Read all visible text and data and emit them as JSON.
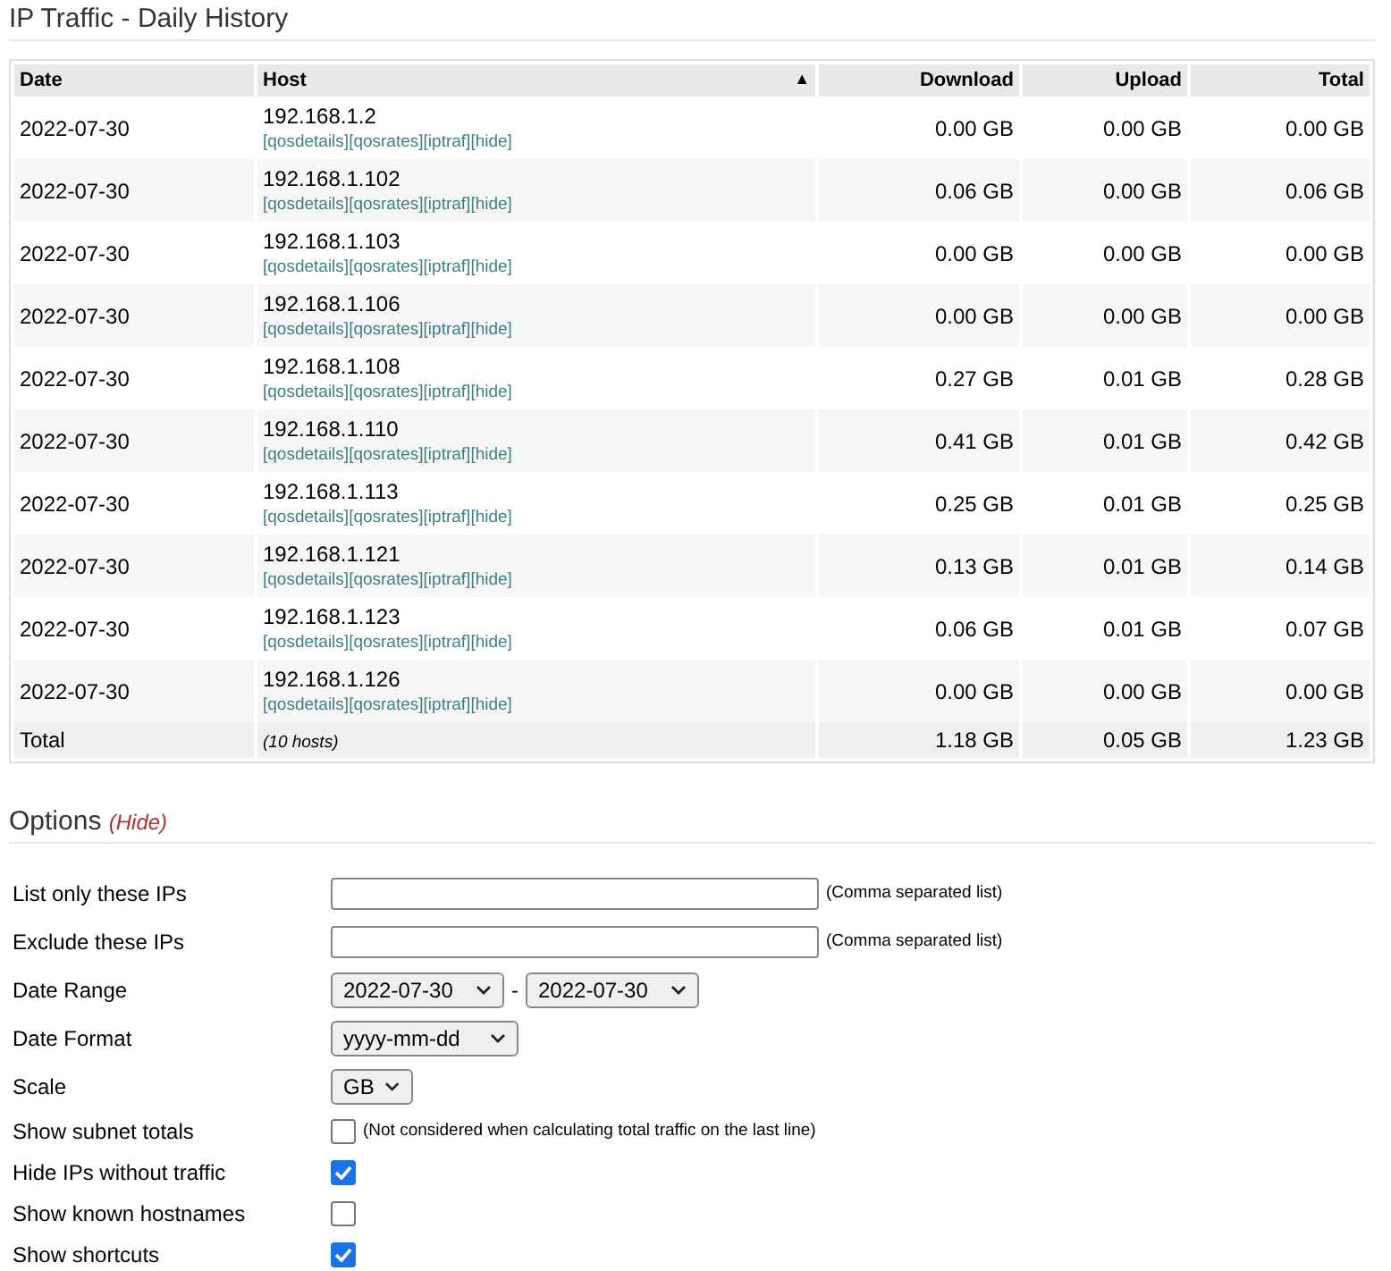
{
  "title": "IP Traffic - Daily History",
  "table": {
    "columns": [
      {
        "label": "Date"
      },
      {
        "label": "Host",
        "sort_indicator": "▲"
      },
      {
        "label": "Download"
      },
      {
        "label": "Upload"
      },
      {
        "label": "Total"
      }
    ],
    "rows": [
      {
        "date": "2022-07-30",
        "host": "192.168.1.2",
        "links": [
          "[qosdetails]",
          "[qosrates]",
          "[iptraf]",
          "[hide]"
        ],
        "download": "0.00 GB",
        "upload": "0.00 GB",
        "total": "0.00 GB"
      },
      {
        "date": "2022-07-30",
        "host": "192.168.1.102",
        "links": [
          "[qosdetails]",
          "[qosrates]",
          "[iptraf]",
          "[hide]"
        ],
        "download": "0.06 GB",
        "upload": "0.00 GB",
        "total": "0.06 GB"
      },
      {
        "date": "2022-07-30",
        "host": "192.168.1.103",
        "links": [
          "[qosdetails]",
          "[qosrates]",
          "[iptraf]",
          "[hide]"
        ],
        "download": "0.00 GB",
        "upload": "0.00 GB",
        "total": "0.00 GB"
      },
      {
        "date": "2022-07-30",
        "host": "192.168.1.106",
        "links": [
          "[qosdetails]",
          "[qosrates]",
          "[iptraf]",
          "[hide]"
        ],
        "download": "0.00 GB",
        "upload": "0.00 GB",
        "total": "0.00 GB"
      },
      {
        "date": "2022-07-30",
        "host": "192.168.1.108",
        "links": [
          "[qosdetails]",
          "[qosrates]",
          "[iptraf]",
          "[hide]"
        ],
        "download": "0.27 GB",
        "upload": "0.01 GB",
        "total": "0.28 GB"
      },
      {
        "date": "2022-07-30",
        "host": "192.168.1.110",
        "links": [
          "[qosdetails]",
          "[qosrates]",
          "[iptraf]",
          "[hide]"
        ],
        "download": "0.41 GB",
        "upload": "0.01 GB",
        "total": "0.42 GB"
      },
      {
        "date": "2022-07-30",
        "host": "192.168.1.113",
        "links": [
          "[qosdetails]",
          "[qosrates]",
          "[iptraf]",
          "[hide]"
        ],
        "download": "0.25 GB",
        "upload": "0.01 GB",
        "total": "0.25 GB"
      },
      {
        "date": "2022-07-30",
        "host": "192.168.1.121",
        "links": [
          "[qosdetails]",
          "[qosrates]",
          "[iptraf]",
          "[hide]"
        ],
        "download": "0.13 GB",
        "upload": "0.01 GB",
        "total": "0.14 GB"
      },
      {
        "date": "2022-07-30",
        "host": "192.168.1.123",
        "links": [
          "[qosdetails]",
          "[qosrates]",
          "[iptraf]",
          "[hide]"
        ],
        "download": "0.06 GB",
        "upload": "0.01 GB",
        "total": "0.07 GB"
      },
      {
        "date": "2022-07-30",
        "host": "192.168.1.126",
        "links": [
          "[qosdetails]",
          "[qosrates]",
          "[iptraf]",
          "[hide]"
        ],
        "download": "0.00 GB",
        "upload": "0.00 GB",
        "total": "0.00 GB"
      }
    ],
    "total": {
      "label": "Total",
      "hosts": "(10 hosts)",
      "download": "1.18 GB",
      "upload": "0.05 GB",
      "total": "1.23 GB"
    }
  },
  "options": {
    "title": "Options",
    "toggle": "(Hide)",
    "fields": [
      {
        "kind": "text",
        "label": "List only these IPs",
        "note": "(Comma separated list)"
      },
      {
        "kind": "text",
        "label": "Exclude these IPs",
        "note": "(Comma separated list)"
      },
      {
        "kind": "range",
        "label": "Date Range",
        "from": "2022-07-30",
        "separator": "-",
        "to": "2022-07-30"
      },
      {
        "kind": "select",
        "label": "Date Format",
        "value": "yyyy-mm-dd"
      },
      {
        "kind": "select",
        "label": "Scale",
        "value": "GB"
      },
      {
        "kind": "checkbox",
        "label": "Show subnet totals",
        "checked": false,
        "note": "(Not considered when calculating total traffic on the last line)"
      },
      {
        "kind": "checkbox",
        "label": "Hide IPs without traffic",
        "checked": true
      },
      {
        "kind": "checkbox",
        "label": "Show known hostnames",
        "checked": false
      },
      {
        "kind": "checkbox",
        "label": "Show shortcuts",
        "checked": true
      }
    ]
  }
}
